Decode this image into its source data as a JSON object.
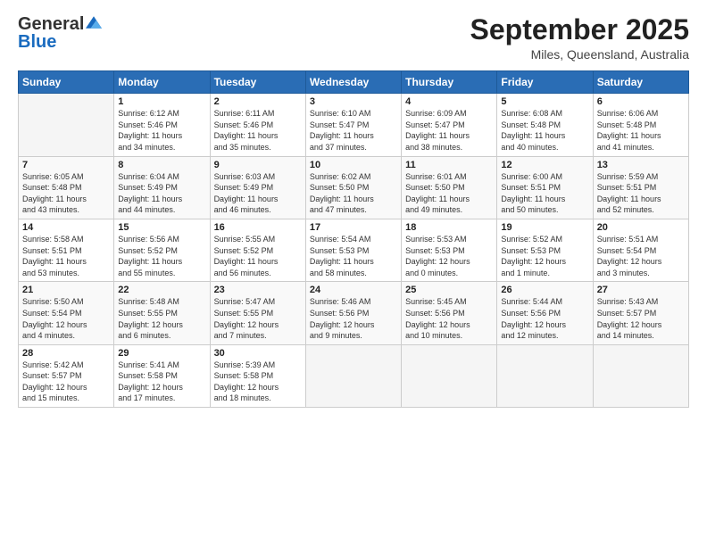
{
  "header": {
    "logo_general": "General",
    "logo_blue": "Blue",
    "title": "September 2025",
    "subtitle": "Miles, Queensland, Australia"
  },
  "days_of_week": [
    "Sunday",
    "Monday",
    "Tuesday",
    "Wednesday",
    "Thursday",
    "Friday",
    "Saturday"
  ],
  "weeks": [
    [
      {
        "day": "",
        "info": ""
      },
      {
        "day": "1",
        "info": "Sunrise: 6:12 AM\nSunset: 5:46 PM\nDaylight: 11 hours\nand 34 minutes."
      },
      {
        "day": "2",
        "info": "Sunrise: 6:11 AM\nSunset: 5:46 PM\nDaylight: 11 hours\nand 35 minutes."
      },
      {
        "day": "3",
        "info": "Sunrise: 6:10 AM\nSunset: 5:47 PM\nDaylight: 11 hours\nand 37 minutes."
      },
      {
        "day": "4",
        "info": "Sunrise: 6:09 AM\nSunset: 5:47 PM\nDaylight: 11 hours\nand 38 minutes."
      },
      {
        "day": "5",
        "info": "Sunrise: 6:08 AM\nSunset: 5:48 PM\nDaylight: 11 hours\nand 40 minutes."
      },
      {
        "day": "6",
        "info": "Sunrise: 6:06 AM\nSunset: 5:48 PM\nDaylight: 11 hours\nand 41 minutes."
      }
    ],
    [
      {
        "day": "7",
        "info": "Sunrise: 6:05 AM\nSunset: 5:48 PM\nDaylight: 11 hours\nand 43 minutes."
      },
      {
        "day": "8",
        "info": "Sunrise: 6:04 AM\nSunset: 5:49 PM\nDaylight: 11 hours\nand 44 minutes."
      },
      {
        "day": "9",
        "info": "Sunrise: 6:03 AM\nSunset: 5:49 PM\nDaylight: 11 hours\nand 46 minutes."
      },
      {
        "day": "10",
        "info": "Sunrise: 6:02 AM\nSunset: 5:50 PM\nDaylight: 11 hours\nand 47 minutes."
      },
      {
        "day": "11",
        "info": "Sunrise: 6:01 AM\nSunset: 5:50 PM\nDaylight: 11 hours\nand 49 minutes."
      },
      {
        "day": "12",
        "info": "Sunrise: 6:00 AM\nSunset: 5:51 PM\nDaylight: 11 hours\nand 50 minutes."
      },
      {
        "day": "13",
        "info": "Sunrise: 5:59 AM\nSunset: 5:51 PM\nDaylight: 11 hours\nand 52 minutes."
      }
    ],
    [
      {
        "day": "14",
        "info": "Sunrise: 5:58 AM\nSunset: 5:51 PM\nDaylight: 11 hours\nand 53 minutes."
      },
      {
        "day": "15",
        "info": "Sunrise: 5:56 AM\nSunset: 5:52 PM\nDaylight: 11 hours\nand 55 minutes."
      },
      {
        "day": "16",
        "info": "Sunrise: 5:55 AM\nSunset: 5:52 PM\nDaylight: 11 hours\nand 56 minutes."
      },
      {
        "day": "17",
        "info": "Sunrise: 5:54 AM\nSunset: 5:53 PM\nDaylight: 11 hours\nand 58 minutes."
      },
      {
        "day": "18",
        "info": "Sunrise: 5:53 AM\nSunset: 5:53 PM\nDaylight: 12 hours\nand 0 minutes."
      },
      {
        "day": "19",
        "info": "Sunrise: 5:52 AM\nSunset: 5:53 PM\nDaylight: 12 hours\nand 1 minute."
      },
      {
        "day": "20",
        "info": "Sunrise: 5:51 AM\nSunset: 5:54 PM\nDaylight: 12 hours\nand 3 minutes."
      }
    ],
    [
      {
        "day": "21",
        "info": "Sunrise: 5:50 AM\nSunset: 5:54 PM\nDaylight: 12 hours\nand 4 minutes."
      },
      {
        "day": "22",
        "info": "Sunrise: 5:48 AM\nSunset: 5:55 PM\nDaylight: 12 hours\nand 6 minutes."
      },
      {
        "day": "23",
        "info": "Sunrise: 5:47 AM\nSunset: 5:55 PM\nDaylight: 12 hours\nand 7 minutes."
      },
      {
        "day": "24",
        "info": "Sunrise: 5:46 AM\nSunset: 5:56 PM\nDaylight: 12 hours\nand 9 minutes."
      },
      {
        "day": "25",
        "info": "Sunrise: 5:45 AM\nSunset: 5:56 PM\nDaylight: 12 hours\nand 10 minutes."
      },
      {
        "day": "26",
        "info": "Sunrise: 5:44 AM\nSunset: 5:56 PM\nDaylight: 12 hours\nand 12 minutes."
      },
      {
        "day": "27",
        "info": "Sunrise: 5:43 AM\nSunset: 5:57 PM\nDaylight: 12 hours\nand 14 minutes."
      }
    ],
    [
      {
        "day": "28",
        "info": "Sunrise: 5:42 AM\nSunset: 5:57 PM\nDaylight: 12 hours\nand 15 minutes."
      },
      {
        "day": "29",
        "info": "Sunrise: 5:41 AM\nSunset: 5:58 PM\nDaylight: 12 hours\nand 17 minutes."
      },
      {
        "day": "30",
        "info": "Sunrise: 5:39 AM\nSunset: 5:58 PM\nDaylight: 12 hours\nand 18 minutes."
      },
      {
        "day": "",
        "info": ""
      },
      {
        "day": "",
        "info": ""
      },
      {
        "day": "",
        "info": ""
      },
      {
        "day": "",
        "info": ""
      }
    ]
  ]
}
